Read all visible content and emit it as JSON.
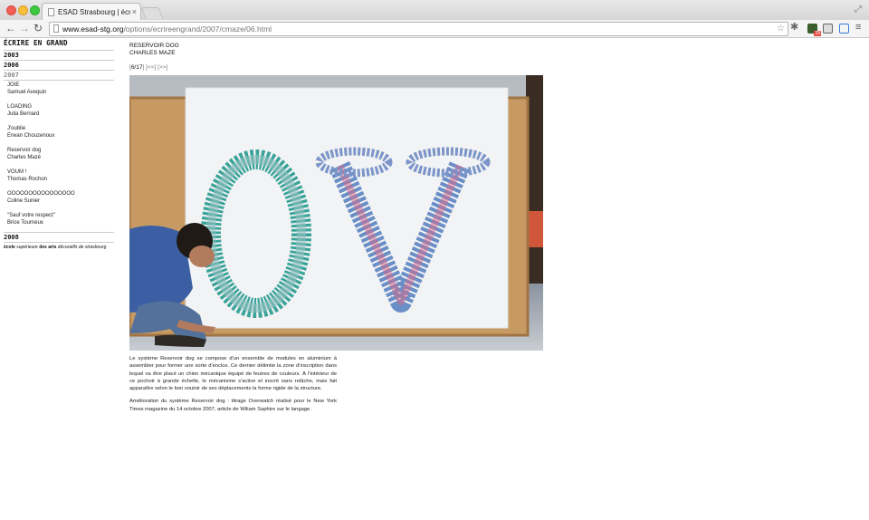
{
  "browser": {
    "tab_title": "ESAD Strasbourg | écrire e",
    "url_host": "www.esad-stg.org",
    "url_path": "/options/ecrireengrand/2007/cmaze/06.html",
    "extension_badge": "29"
  },
  "sidebar": {
    "logo": "ÉCRIRE EN GRAND",
    "years": [
      "2003",
      "2006",
      "2007",
      "2008"
    ],
    "active_year": "2007",
    "projects": [
      {
        "title": "JOIE",
        "author": "Samuel Avequin"
      },
      {
        "title": "LOADING",
        "author": "Julia Bernard"
      },
      {
        "title": "J'oublie",
        "author": "Erwan Chouzenoux"
      },
      {
        "title": "Reservoir dog",
        "author": "Charles Mazé"
      },
      {
        "title": "VOUM !",
        "author": "Thomas Rochon"
      },
      {
        "title": "OOOOOOOOOOOOOOOO",
        "author": "Coline Sunier"
      },
      {
        "title": "\"Sauf votre respect\"",
        "author": "Brice Tourneux"
      }
    ],
    "school": {
      "part1": "école",
      "part2": "supérieure",
      "part3": "des arts",
      "part4": "décoratifs de strasbourg"
    }
  },
  "main": {
    "title": "RESERVOIR DOG",
    "author": "CHARLES MAZE",
    "pager": {
      "open": "[",
      "count": "6/17",
      "close": "]",
      "prev": "[<<]",
      "next": "[>>]"
    },
    "photo_letters": "OV",
    "caption": [
      "Le système Reservoir dog se compose d'un ensemble de modules en aluminium à assembler pour former une sorte d'enclos. Ce dernier délimite la zone d'inscription dans lequel va être placé un chien mécanique équipé de feutres de couleurs. À l'intérieur de ce pochoir à grande échelle, le mécanisme s'active et inscrit sans relâche, mais fait apparaître selon le bon vouloir de ses déplacements la forme rigide de la structure.",
      "Amélioration du système Reservoir dog : titrage Overwatch réalisé pour le New York Times magazine du 14 octobre 2007, article de Wiliam Saphire sur le langage."
    ]
  }
}
